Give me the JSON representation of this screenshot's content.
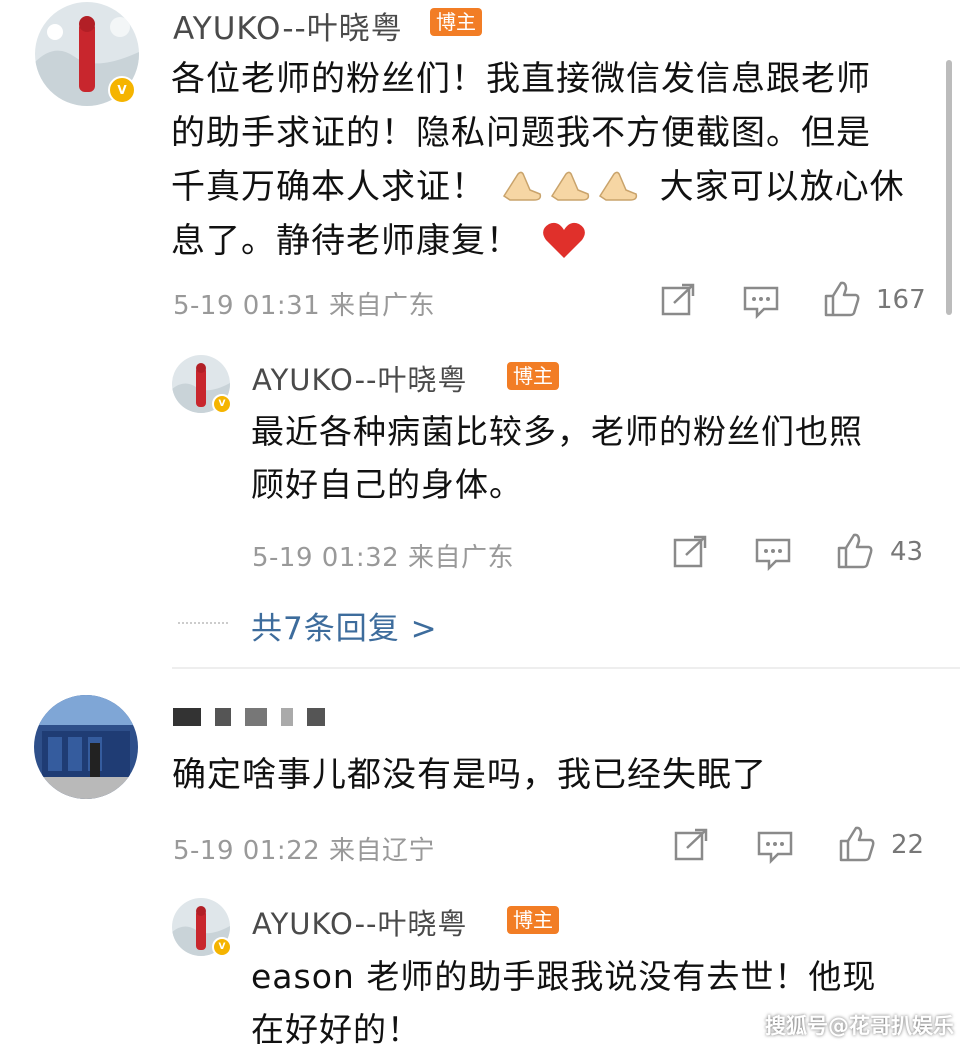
{
  "comments": [
    {
      "username": "AYUKO--叶晓粤",
      "tag": "博主",
      "text_lines": [
        "各位老师的粉丝们！我直接微信发信息跟老师",
        "的助手求证的！隐私问题我不方便截图。但是",
        "千真万确本人求证！",
        "大家可以放心休",
        "息了。静待老师康复！"
      ],
      "meta": "5-19 01:31 来自广东",
      "likes": "167",
      "reply": {
        "username": "AYUKO--叶晓粤",
        "tag": "博主",
        "text_lines": [
          "最近各种病菌比较多，老师的粉丝们也照",
          "顾好自己的身体。"
        ],
        "meta": "5-19 01:32 来自广东",
        "likes": "43"
      },
      "more_replies": "共7条回复 >"
    },
    {
      "text": "确定啥事儿都没有是吗，我已经失眠了",
      "meta": "5-19 01:22 来自辽宁",
      "likes": "22",
      "reply": {
        "username": "AYUKO--叶晓粤",
        "tag": "博主",
        "text_lines": [
          "eason 老师的助手跟我说没有去世！他现",
          "在好好的！"
        ]
      }
    }
  ],
  "watermark": "搜狐号@花哥扒娱乐",
  "icons": {
    "forward": "share-icon",
    "comment": "comment-icon",
    "like": "like-icon",
    "emoji_pray": "pray-emoji-icon",
    "emoji_heart": "heart-emoji-icon"
  },
  "colors": {
    "tag": "#f27d25",
    "link": "#3d6c9c",
    "verify": "#f5b400",
    "heart": "#e0302b"
  }
}
